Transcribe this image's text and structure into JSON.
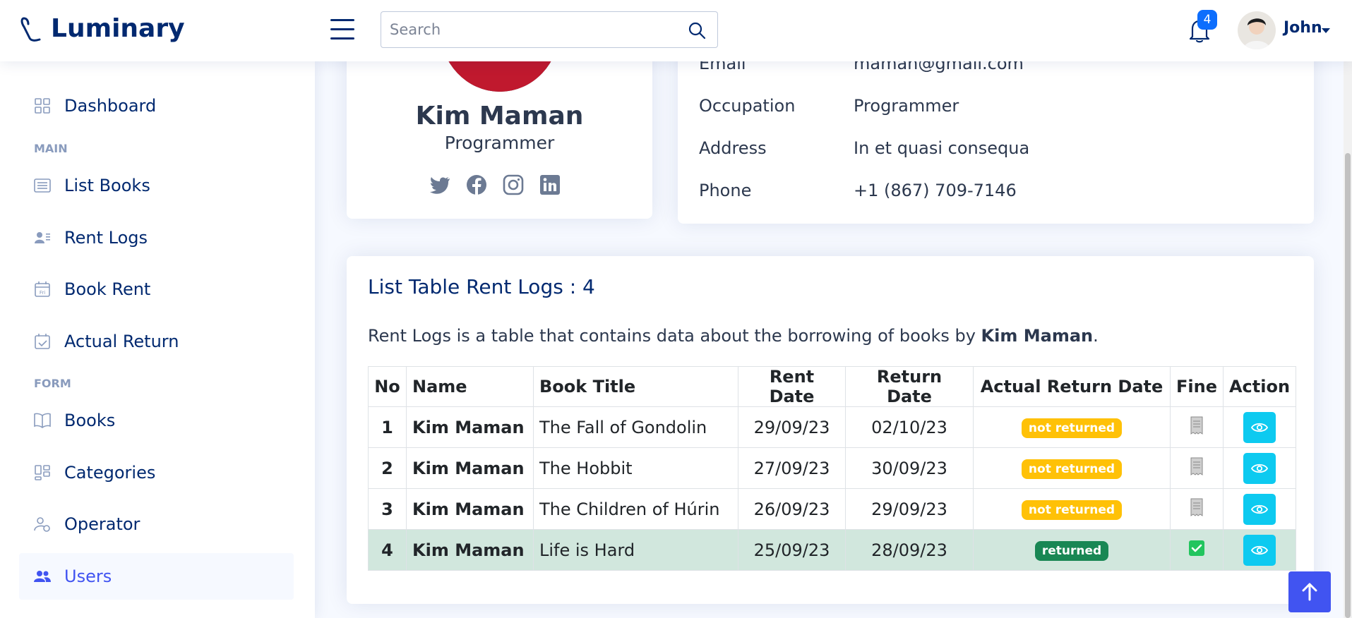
{
  "header": {
    "brand": "Luminary",
    "search_placeholder": "Search",
    "notification_count": "4",
    "user_name": "John"
  },
  "sidebar": {
    "items": [
      {
        "label": "Dashboard"
      },
      {
        "label": "List Books"
      },
      {
        "label": "Rent Logs"
      },
      {
        "label": "Book Rent"
      },
      {
        "label": "Actual Return"
      },
      {
        "label": "Books"
      },
      {
        "label": "Categories"
      },
      {
        "label": "Operator"
      },
      {
        "label": "Users"
      }
    ],
    "headings": [
      "MAIN",
      "FORM"
    ]
  },
  "profile": {
    "name": "Kim Maman",
    "job": "Programmer",
    "details": [
      {
        "label": "Email",
        "value": "maman@gmail.com"
      },
      {
        "label": "Occupation",
        "value": "Programmer"
      },
      {
        "label": "Address",
        "value": "In et quasi consequa"
      },
      {
        "label": "Phone",
        "value": "+1 (867) 709-7146"
      }
    ]
  },
  "rent_logs": {
    "title": "List Table Rent Logs : 4",
    "desc_prefix": "Rent Logs is a table that contains data about the borrowing of books by ",
    "desc_name": "Kim Maman",
    "desc_suffix": ".",
    "columns": [
      "No",
      "Name",
      "Book Title",
      "Rent Date",
      "Return Date",
      "Actual Return Date",
      "Fine",
      "Action"
    ],
    "rows": [
      {
        "no": "1",
        "name": "Kim Maman",
        "title": "The Fall of Gondolin",
        "rent": "29/09/23",
        "ret": "02/10/23",
        "actual": "not returned",
        "status": "warn"
      },
      {
        "no": "2",
        "name": "Kim Maman",
        "title": "The Hobbit",
        "rent": "27/09/23",
        "ret": "30/09/23",
        "actual": "not returned",
        "status": "warn"
      },
      {
        "no": "3",
        "name": "Kim Maman",
        "title": "The Children of Húrin",
        "rent": "26/09/23",
        "ret": "29/09/23",
        "actual": "not returned",
        "status": "warn"
      },
      {
        "no": "4",
        "name": "Kim Maman",
        "title": "Life is Hard",
        "rent": "25/09/23",
        "ret": "28/09/23",
        "actual": "returned",
        "status": "ok"
      }
    ]
  },
  "colors": {
    "primary": "#012970",
    "accent": "#4154f1",
    "warning": "#ffc107",
    "success": "#198754",
    "info": "#0dcaf0"
  }
}
